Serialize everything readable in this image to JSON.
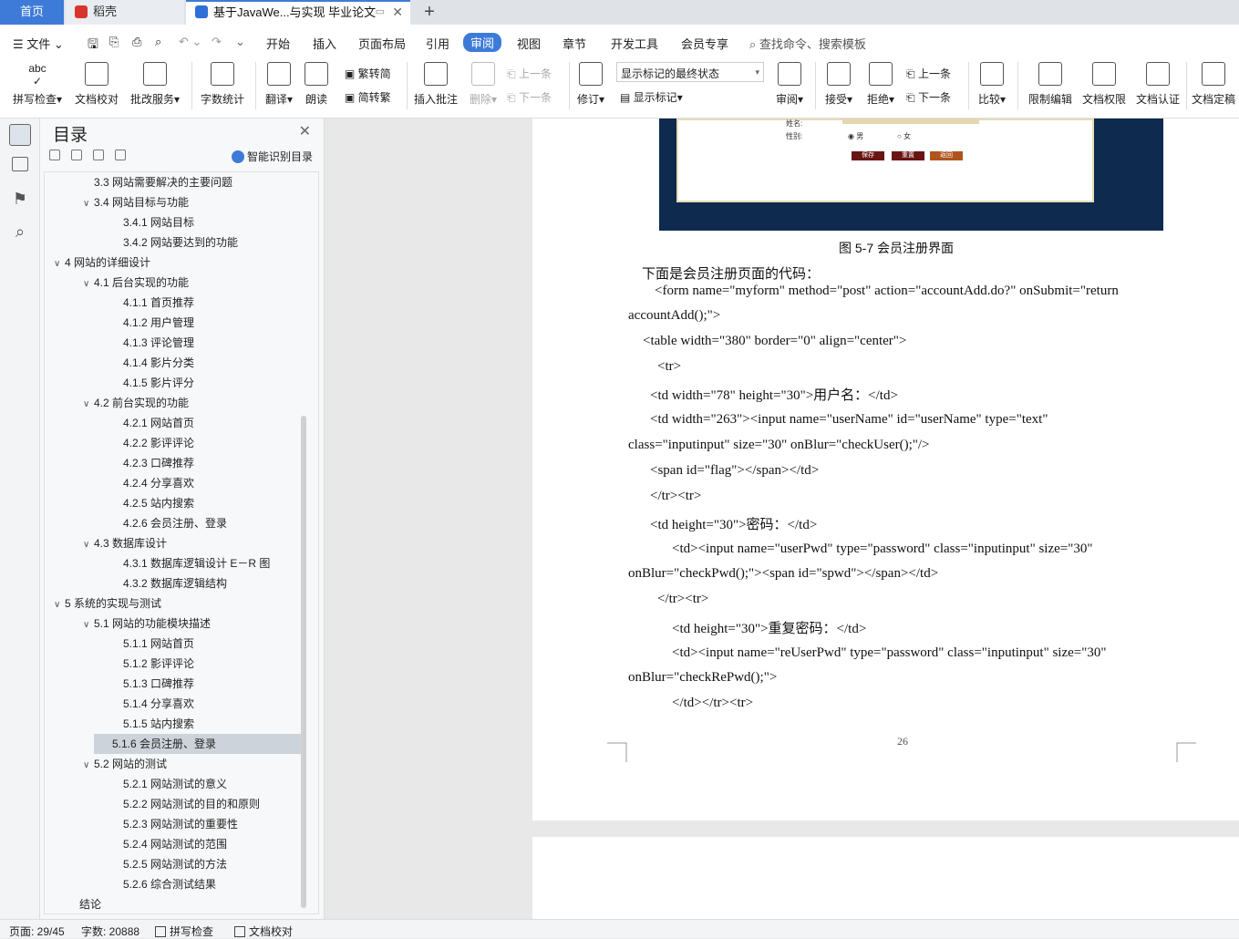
{
  "tabs": {
    "home": "首页",
    "daoke": "稻壳",
    "doc": "基于JavaWe...与实现 毕业论文"
  },
  "menu": {
    "file": "文件",
    "items": [
      "开始",
      "插入",
      "页面布局",
      "引用",
      "审阅",
      "视图",
      "章节",
      "开发工具",
      "会员专享"
    ],
    "search": "查找命令、搜索模板"
  },
  "ribbon": {
    "spell": "拼写检查",
    "proof": "文档校对",
    "review_service": "批改服务",
    "wordcount": "字数统计",
    "translate": "翻译",
    "read": "朗读",
    "trad": "繁转简",
    "simp": "简转繁",
    "comment": "插入批注",
    "delete": "删除",
    "prev": "上一条",
    "next": "下一条",
    "revise": "修订",
    "markup_state": "显示标记的最终状态",
    "show_markup": "显示标记",
    "review": "审阅",
    "accept": "接受",
    "reject": "拒绝",
    "prev2": "上一条",
    "next2": "下一条",
    "compare": "比较",
    "restrict": "限制编辑",
    "perm": "文档权限",
    "cert": "文档认证",
    "final": "文档定稿"
  },
  "toc": {
    "title": "目录",
    "smart": "智能识别目录",
    "items": [
      {
        "t": "3.3   网站需要解决的主要问题",
        "lv": 2,
        "chev": ""
      },
      {
        "t": "3.4   网站目标与功能",
        "lv": 2,
        "chev": "v"
      },
      {
        "t": "3.4.1    网站目标",
        "lv": 3,
        "chev": ""
      },
      {
        "t": "3.4.2    网站要达到的功能",
        "lv": 3,
        "chev": ""
      },
      {
        "t": "4   网站的详细设计",
        "lv": 1,
        "chev": "v"
      },
      {
        "t": "4.1   后台实现的功能",
        "lv": 2,
        "chev": "v"
      },
      {
        "t": "4.1.1    首页推荐",
        "lv": 3,
        "chev": ""
      },
      {
        "t": "4.1.2    用户管理",
        "lv": 3,
        "chev": ""
      },
      {
        "t": "4.1.3    评论管理",
        "lv": 3,
        "chev": ""
      },
      {
        "t": "4.1.4    影片分类",
        "lv": 3,
        "chev": ""
      },
      {
        "t": "4.1.5    影片评分",
        "lv": 3,
        "chev": ""
      },
      {
        "t": "4.2   前台实现的功能",
        "lv": 2,
        "chev": "v"
      },
      {
        "t": "4.2.1    网站首页",
        "lv": 3,
        "chev": ""
      },
      {
        "t": "4.2.2    影评评论",
        "lv": 3,
        "chev": ""
      },
      {
        "t": "4.2.3    口碑推荐",
        "lv": 3,
        "chev": ""
      },
      {
        "t": "4.2.4    分享喜欢",
        "lv": 3,
        "chev": ""
      },
      {
        "t": "4.2.5    站内搜索",
        "lv": 3,
        "chev": ""
      },
      {
        "t": "4.2.6    会员注册、登录",
        "lv": 3,
        "chev": ""
      },
      {
        "t": "4.3   数据库设计",
        "lv": 2,
        "chev": "v"
      },
      {
        "t": "4.3.1    数据库逻辑设计 E－R 图",
        "lv": 3,
        "chev": ""
      },
      {
        "t": "4.3.2    数据库逻辑结构",
        "lv": 3,
        "chev": ""
      },
      {
        "t": "5    系统的实现与测试",
        "lv": 1,
        "chev": "v"
      },
      {
        "t": "5.1   网站的功能模块描述",
        "lv": 2,
        "chev": "v"
      },
      {
        "t": "5.1.1    网站首页",
        "lv": 3,
        "chev": ""
      },
      {
        "t": "5.1.2    影评评论",
        "lv": 3,
        "chev": ""
      },
      {
        "t": "5.1.3    口碑推荐",
        "lv": 3,
        "chev": ""
      },
      {
        "t": "5.1.4    分享喜欢",
        "lv": 3,
        "chev": ""
      },
      {
        "t": "5.1.5    站内搜索",
        "lv": 3,
        "chev": ""
      },
      {
        "t": "5.1.6    会员注册、登录",
        "lv": 3,
        "chev": "",
        "sel": true
      },
      {
        "t": "5.2   网站的测试",
        "lv": 2,
        "chev": "v"
      },
      {
        "t": "5.2.1     网站测试的意义",
        "lv": 3,
        "chev": ""
      },
      {
        "t": "5.2.2    网站测试的目的和原则",
        "lv": 3,
        "chev": ""
      },
      {
        "t": "5.2.3    网站测试的重要性",
        "lv": 3,
        "chev": ""
      },
      {
        "t": "5.2.4    网站测试的范围",
        "lv": 3,
        "chev": ""
      },
      {
        "t": "5.2.5    网站测试的方法",
        "lv": 3,
        "chev": ""
      },
      {
        "t": "5.2.6    综合测试结果",
        "lv": 3,
        "chev": ""
      },
      {
        "t": "结论",
        "lv": 0,
        "chev": ""
      }
    ]
  },
  "doc": {
    "figure": {
      "name_label": "姓名:",
      "gender_label": "性别:",
      "male": "男",
      "female": "女",
      "save": "保存",
      "reset": "重置",
      "back": "返回"
    },
    "caption": "图 5-7   会员注册界面",
    "intro": "下面是会员注册页面的代码：",
    "code": [
      "<form  name=\"myform\"  method=\"post\"  action=\"accountAdd.do?\"  onSubmit=\"return",
      "accountAdd();\">",
      "<table width=\"380\" border=\"0\" align=\"center\">",
      "<tr>",
      "<td width=\"78\" height=\"30\">用户名：</td>",
      "<td      width=\"263\"><input      name=\"userName\"      id=\"userName\"      type=\"text\"",
      "class=\"inputinput\" size=\"30\" onBlur=\"checkUser();\"/>",
      "<span id=\"flag\"></span></td>",
      "</tr><tr>",
      "<td height=\"30\">密码：</td>",
      "<td><input   name=\"userPwd\"   type=\"password\"   class=\"inputinput\"     size=\"30\"",
      "onBlur=\"checkPwd();\"><span id=\"spwd\"></span></td>",
      "</tr><tr>",
      "<td height=\"30\">重复密码：</td>",
      "<td><input  name=\"reUserPwd\"  type=\"password\"  class=\"inputinput\"    size=\"30\"",
      "onBlur=\"checkRePwd();\">",
      "</td></tr><tr>"
    ],
    "page_number": "26"
  },
  "status": {
    "page": "页面: 29/45",
    "words": "字数: 20888",
    "spell": "拼写检查",
    "proof": "文档校对"
  }
}
